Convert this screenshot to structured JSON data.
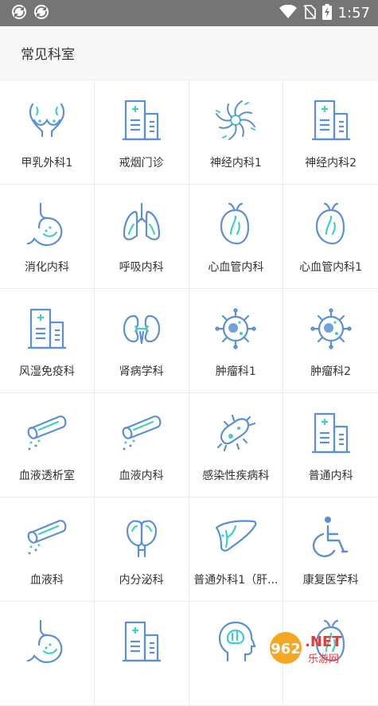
{
  "status_bar": {
    "time": "1:57",
    "left_icons": [
      "sync-icon",
      "sync-icon"
    ],
    "right_icons": [
      "wifi-icon",
      "no-sim-icon",
      "battery-charging-icon"
    ]
  },
  "header": {
    "title": "常见科室"
  },
  "colors": {
    "icon_blue": "#5b8fd6",
    "icon_teal": "#3fcfc8",
    "status_bar_bg": "#757575",
    "header_bg": "#f7f7f7"
  },
  "departments": [
    {
      "label": "甲乳外科1",
      "icon": "breast-icon"
    },
    {
      "label": "戒烟门诊",
      "icon": "hospital-building-icon"
    },
    {
      "label": "神经内科1",
      "icon": "neuron-icon"
    },
    {
      "label": "神经内科2",
      "icon": "hospital-building-icon"
    },
    {
      "label": "消化内科",
      "icon": "stomach-icon"
    },
    {
      "label": "呼吸内科",
      "icon": "lungs-icon"
    },
    {
      "label": "心血管内科",
      "icon": "heart-icon"
    },
    {
      "label": "心血管内科1",
      "icon": "heart-icon"
    },
    {
      "label": "风湿免疫科",
      "icon": "hospital-building-icon"
    },
    {
      "label": "肾病学科",
      "icon": "kidneys-icon"
    },
    {
      "label": "肿瘤科1",
      "icon": "tumor-cell-icon"
    },
    {
      "label": "肿瘤科2",
      "icon": "tumor-cell-icon"
    },
    {
      "label": "血液透析室",
      "icon": "blood-tube-icon"
    },
    {
      "label": "血液内科",
      "icon": "blood-tube-icon"
    },
    {
      "label": "感染性疾病科",
      "icon": "bacteria-icon"
    },
    {
      "label": "普通内科",
      "icon": "hospital-building-icon"
    },
    {
      "label": "血液科",
      "icon": "blood-tube-icon"
    },
    {
      "label": "内分泌科",
      "icon": "thyroid-icon"
    },
    {
      "label": "普通外科1（肝...",
      "icon": "liver-icon"
    },
    {
      "label": "康复医学科",
      "icon": "wheelchair-icon"
    },
    {
      "label": "",
      "icon": "stomach-icon"
    },
    {
      "label": "",
      "icon": "hospital-building-icon"
    },
    {
      "label": "",
      "icon": "brain-head-icon"
    },
    {
      "label": "",
      "icon": "heart-icon"
    }
  ],
  "watermark": {
    "logo_text": "962",
    "suffix": ".NET",
    "sub_text": "乐游网"
  }
}
